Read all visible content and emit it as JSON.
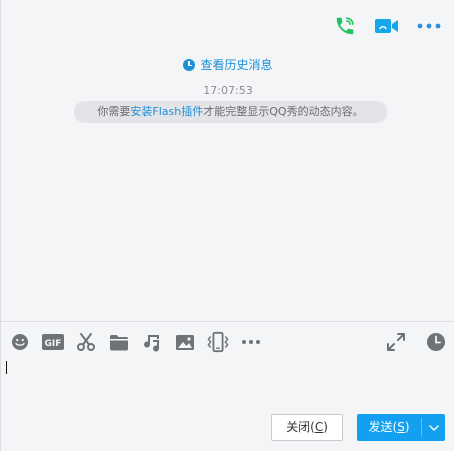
{
  "header": {
    "icons": [
      "phone-call-icon",
      "video-call-icon",
      "more-icon"
    ],
    "colors": {
      "phone": "#1ec35f",
      "video": "#16a7e9",
      "more": "#2b90d9"
    }
  },
  "messages": {
    "history_link": "查看历史消息",
    "timestamp": "17:07:53",
    "notice": {
      "before": "你需要",
      "link": "安装Flash插件",
      "after": "才能完整显示QQ秀的动态内容。"
    }
  },
  "toolbar": {
    "tools": [
      "emoji-icon",
      "gif-icon",
      "scissors-icon",
      "folder-icon",
      "music-icon",
      "image-icon",
      "shake-icon",
      "more-icon"
    ],
    "gif_label": "GIF",
    "right_tools": [
      "expand-icon",
      "history-clock-icon"
    ]
  },
  "input": {
    "value": ""
  },
  "buttons": {
    "close_label": "关闭",
    "close_key": "C",
    "send_label": "发送",
    "send_key": "S"
  },
  "colors": {
    "accent": "#14a0f0",
    "link": "#1e90d7"
  }
}
